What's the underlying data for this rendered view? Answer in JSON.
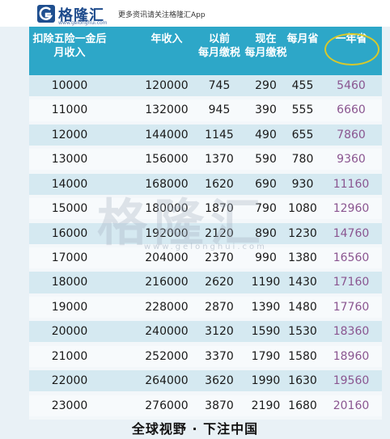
{
  "brand": {
    "name": "格隆汇",
    "url": "www.gelonghui.com",
    "tagline": "更多资讯请关注格隆汇App",
    "logo_icon": "gelonghui-g-logo-icon",
    "color": "#1e4b8c"
  },
  "table": {
    "header_color": "#2da7c8",
    "headers": [
      {
        "lines": [
          "扣除五险一金后",
          "月收入"
        ]
      },
      {
        "lines": [
          "",
          "年收入"
        ]
      },
      {
        "lines": [
          "以前",
          "每月缴税"
        ]
      },
      {
        "lines": [
          "现在",
          "每月缴税"
        ]
      },
      {
        "lines": [
          "",
          "每月省"
        ]
      },
      {
        "lines": [
          "",
          "一年省"
        ]
      }
    ],
    "rows": [
      [
        "10000",
        "120000",
        "745",
        "290",
        "455",
        "5460"
      ],
      [
        "11000",
        "132000",
        "945",
        "390",
        "555",
        "6660"
      ],
      [
        "12000",
        "144000",
        "1145",
        "490",
        "655",
        "7860"
      ],
      [
        "13000",
        "156000",
        "1370",
        "590",
        "780",
        "9360"
      ],
      [
        "14000",
        "168000",
        "1620",
        "690",
        "930",
        "11160"
      ],
      [
        "15000",
        "180000",
        "1870",
        "790",
        "1080",
        "12960"
      ],
      [
        "16000",
        "192000",
        "2120",
        "890",
        "1230",
        "14760"
      ],
      [
        "17000",
        "204000",
        "2370",
        "990",
        "1380",
        "16560"
      ],
      [
        "18000",
        "216000",
        "2620",
        "1190",
        "1430",
        "17160"
      ],
      [
        "19000",
        "228000",
        "2870",
        "1390",
        "1480",
        "17760"
      ],
      [
        "20000",
        "240000",
        "3120",
        "1590",
        "1530",
        "18360"
      ],
      [
        "21000",
        "252000",
        "3370",
        "1790",
        "1580",
        "18960"
      ],
      [
        "22000",
        "264000",
        "3620",
        "1990",
        "1630",
        "19560"
      ],
      [
        "23000",
        "276000",
        "3870",
        "2190",
        "1680",
        "20160"
      ]
    ]
  },
  "watermark": {
    "text": "格隆汇",
    "url": "www.gelonghui.com"
  },
  "footer": {
    "text": "全球视野 · 下注中国"
  }
}
